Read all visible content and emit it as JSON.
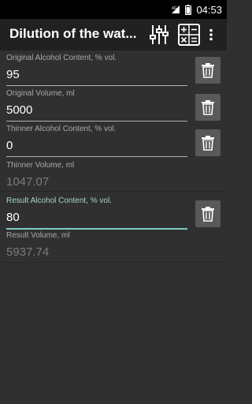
{
  "status": {
    "time": "04:53"
  },
  "appbar": {
    "title": "Dilution of the water-alcohol solution"
  },
  "fields": [
    {
      "label": "Original Alcohol Content, % vol.",
      "value": "95"
    },
    {
      "label": "Original Volume, ml",
      "value": "5000"
    },
    {
      "label": "Thinner Alcohol Content, % vol.",
      "value": "0"
    },
    {
      "label": "Thinner Volume, ml",
      "value": "1047.07"
    },
    {
      "label": "Result Alcohol Content, % vol.",
      "value": "80"
    },
    {
      "label": "Result Volume, ml",
      "value": "5937.74"
    }
  ],
  "icons": {
    "settings": "sliders-icon",
    "calculator": "calculator-icon",
    "overflow": "more-vert-icon",
    "delete": "trash-icon"
  },
  "colors": {
    "accent": "#80cbc4",
    "background": "#303030",
    "appbar": "#212121"
  }
}
